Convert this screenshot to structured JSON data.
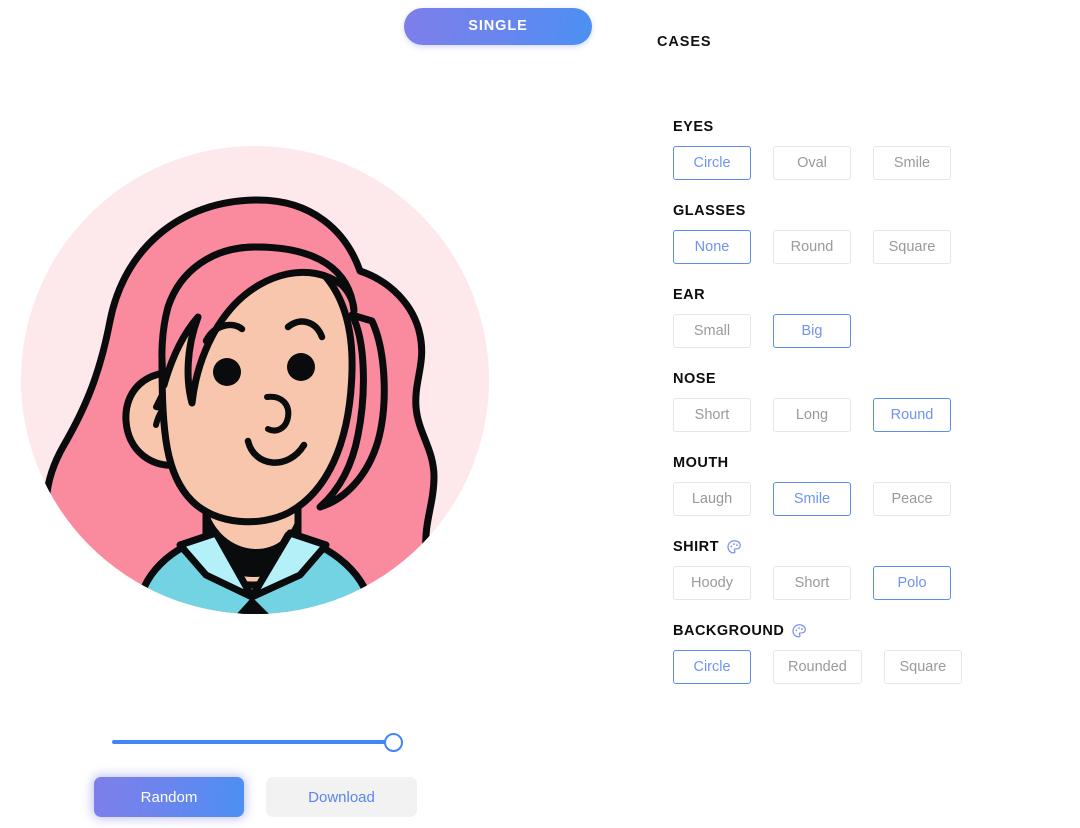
{
  "tabs": [
    {
      "id": "single",
      "label": "SINGLE",
      "active": true
    },
    {
      "id": "cases",
      "label": "CASES",
      "active": false
    }
  ],
  "avatar": {
    "name": "avatar-preview",
    "background_shape": "Circle",
    "colors": {
      "background_circle": "#fde8ec",
      "hair": "#fa8b9e",
      "skin": "#f7c6ac",
      "shirt": "#72d3e3",
      "collar": "#b4f0f7",
      "outline": "#090b0d",
      "neck_shadow": "#090b0d"
    },
    "features": {
      "eyes": "Circle",
      "glasses": "None",
      "ear": "Big",
      "nose": "Round",
      "mouth": "Smile",
      "shirt": "Polo"
    }
  },
  "slider": {
    "name": "zoom-slider",
    "value": 100,
    "min": 0,
    "max": 100,
    "track_color": "#4285f4"
  },
  "actions": {
    "random_label": "Random",
    "download_label": "Download"
  },
  "options": [
    {
      "id": "eyes",
      "label": "EYES",
      "has_palette": false,
      "choices": [
        {
          "label": "Circle",
          "selected": true
        },
        {
          "label": "Oval",
          "selected": false
        },
        {
          "label": "Smile",
          "selected": false
        }
      ]
    },
    {
      "id": "glasses",
      "label": "GLASSES",
      "has_palette": false,
      "choices": [
        {
          "label": "None",
          "selected": true
        },
        {
          "label": "Round",
          "selected": false
        },
        {
          "label": "Square",
          "selected": false
        }
      ]
    },
    {
      "id": "ear",
      "label": "EAR",
      "has_palette": false,
      "choices": [
        {
          "label": "Small",
          "selected": false
        },
        {
          "label": "Big",
          "selected": true
        }
      ]
    },
    {
      "id": "nose",
      "label": "NOSE",
      "has_palette": false,
      "choices": [
        {
          "label": "Short",
          "selected": false
        },
        {
          "label": "Long",
          "selected": false
        },
        {
          "label": "Round",
          "selected": true
        }
      ]
    },
    {
      "id": "mouth",
      "label": "MOUTH",
      "has_palette": false,
      "choices": [
        {
          "label": "Laugh",
          "selected": false
        },
        {
          "label": "Smile",
          "selected": true
        },
        {
          "label": "Peace",
          "selected": false
        }
      ]
    },
    {
      "id": "shirt",
      "label": "SHIRT",
      "has_palette": true,
      "palette_icon": "palette-icon",
      "choices": [
        {
          "label": "Hoody",
          "selected": false
        },
        {
          "label": "Short",
          "selected": false
        },
        {
          "label": "Polo",
          "selected": true
        }
      ]
    },
    {
      "id": "background",
      "label": "BACKGROUND",
      "has_palette": true,
      "palette_icon": "palette-icon",
      "choices": [
        {
          "label": "Circle",
          "selected": true
        },
        {
          "label": "Rounded",
          "selected": false
        },
        {
          "label": "Square",
          "selected": false
        }
      ]
    }
  ],
  "theme": {
    "accent_blue": "#4285f4",
    "accent_purple": "#7f7eea",
    "selected_border": "#5b8def",
    "selected_text": "#6f93f0",
    "idle_text": "#9a9a9e",
    "idle_border": "#e6e6e8"
  }
}
